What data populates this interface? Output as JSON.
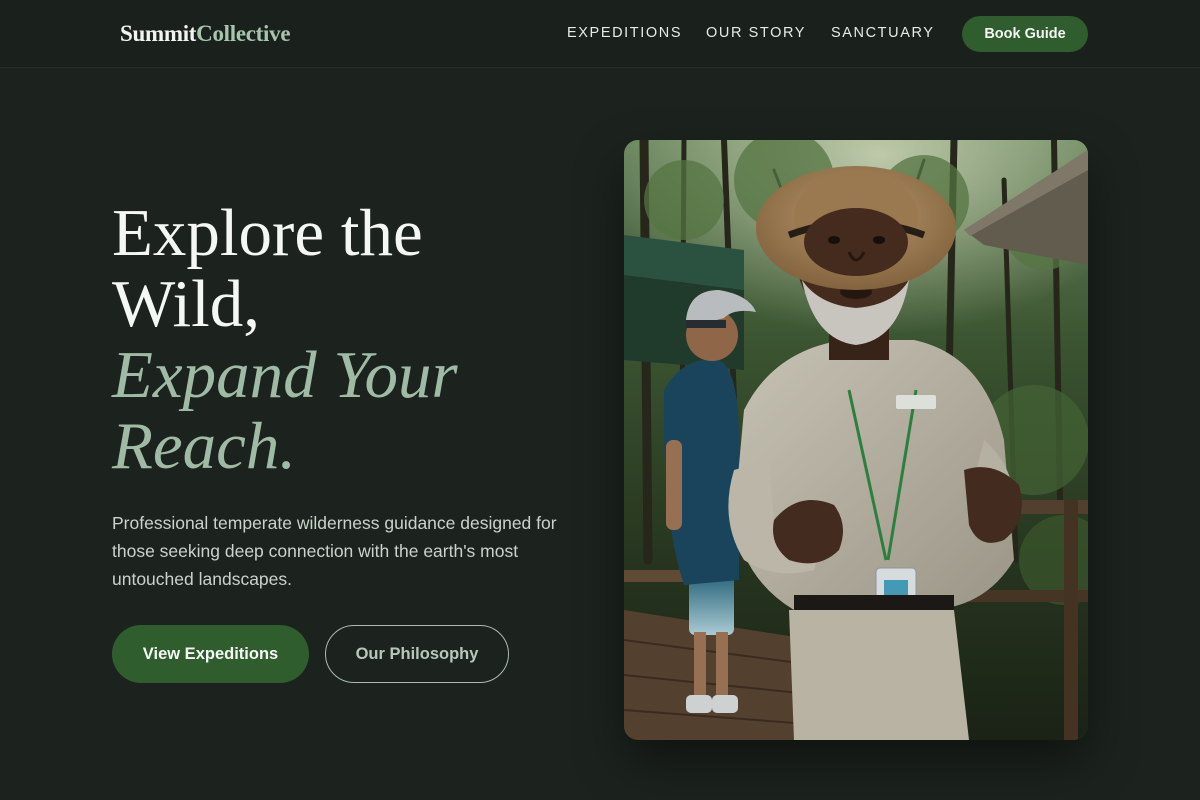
{
  "nav": {
    "brand_part1": "Summit",
    "brand_part2": "Collective",
    "links": [
      {
        "label": "EXPEDITIONS"
      },
      {
        "label": "OUR STORY"
      },
      {
        "label": "SANCTUARY"
      }
    ],
    "cta_label": "Book Guide"
  },
  "hero": {
    "headline_line1": "Explore the",
    "headline_line2": "Wild,",
    "headline_accent_line1": "Expand Your",
    "headline_accent_line2": "Reach.",
    "subtitle": "Professional temperate wilderness guidance designed for those seeking deep connection with the earth's most untouched landscapes.",
    "primary_button": "View Expeditions",
    "secondary_button": "Our Philosophy",
    "image_subject": "guide-with-hiker-photo"
  },
  "colors": {
    "background": "#1c231e",
    "accent_green": "#2f5d2d",
    "accent_sage": "#9fbaa5"
  }
}
